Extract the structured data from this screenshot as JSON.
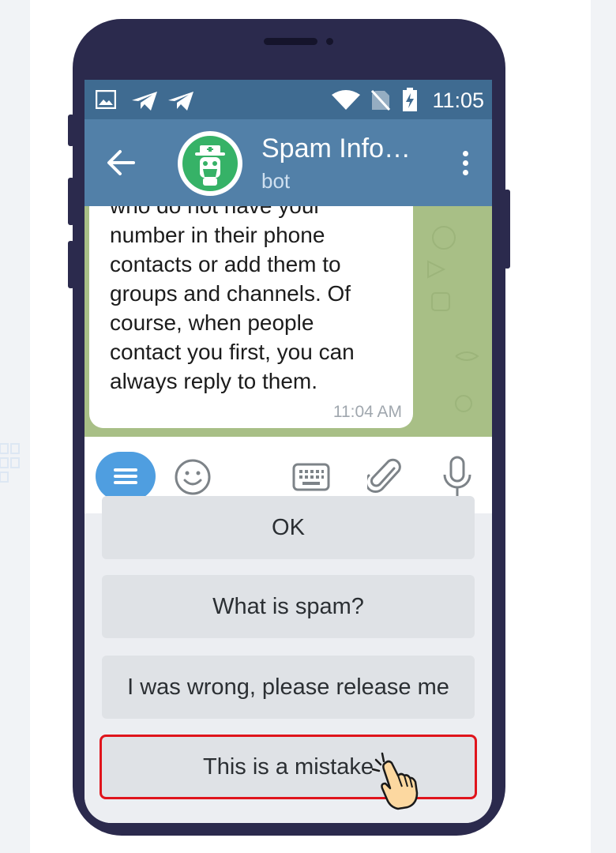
{
  "status_bar": {
    "time": "11:05",
    "icons": [
      "image-icon",
      "telegram-icon",
      "telegram-icon",
      "wifi-icon",
      "no-sim-icon",
      "battery-charging-icon"
    ]
  },
  "chat_header": {
    "title": "Spam Info…",
    "subtitle": "bot",
    "avatar_icon": "spam-bot-avatar-icon",
    "accent": "#5280a8"
  },
  "message": {
    "lines": [
      "who do not have your",
      "number in their phone",
      "contacts or add them to",
      "groups and channels. Of",
      "course, when people",
      "contact you first, you can",
      "always reply to them."
    ],
    "time": "11:04 AM"
  },
  "input_bar": {
    "icons": [
      "keyboard-menu-icon",
      "emoji-icon",
      "keyboard-icon",
      "attach-icon",
      "microphone-icon"
    ]
  },
  "reply_keyboard": {
    "buttons": [
      "OK",
      "What is spam?",
      "I was wrong, please release me",
      "This is a mistake"
    ],
    "highlight_color": "#e0141c"
  }
}
